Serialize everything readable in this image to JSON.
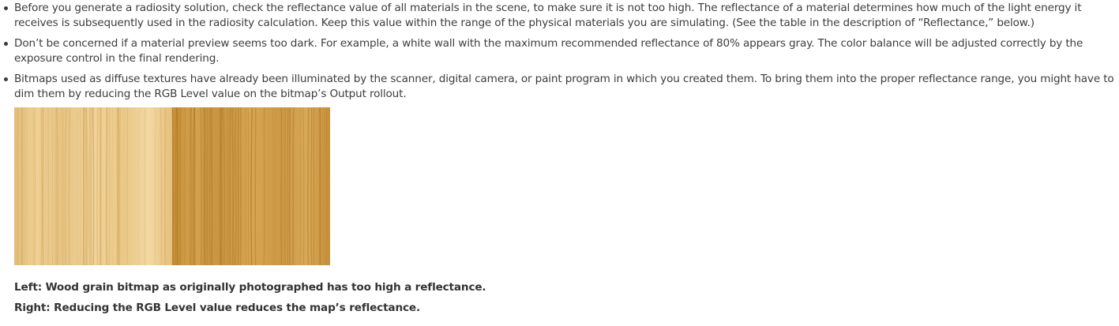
{
  "bullets": [
    "Before you generate a radiosity solution, check the reflectance value of all materials in the scene, to make sure it is not too high. The reflectance of a material determines how much of the light energy it receives is subsequently used in the radiosity calculation. Keep this value within the range of the physical materials you are simulating. (See the table in the description of “Reflectance,” below.)",
    "Don’t be concerned if a material preview seems too dark. For example, a white wall with the maximum recommended reflectance of 80% appears gray. The color balance will be adjusted correctly by the exposure control in the final rendering.",
    "Bitmaps used as diffuse textures have already been illuminated by the scanner, digital camera, or paint program in which you created them. To bring them into the proper reflectance range, you might have to dim them by reducing the RGB Level value on the bitmap’s Output rollout."
  ],
  "figure": {
    "left_color": "#ebc985",
    "right_color": "#cf9a43"
  },
  "captions": {
    "left": "Left: Wood grain bitmap as originally photographed has too high a reflectance.",
    "right": "Right: Reducing the RGB Level value reduces the map’s reflectance."
  }
}
